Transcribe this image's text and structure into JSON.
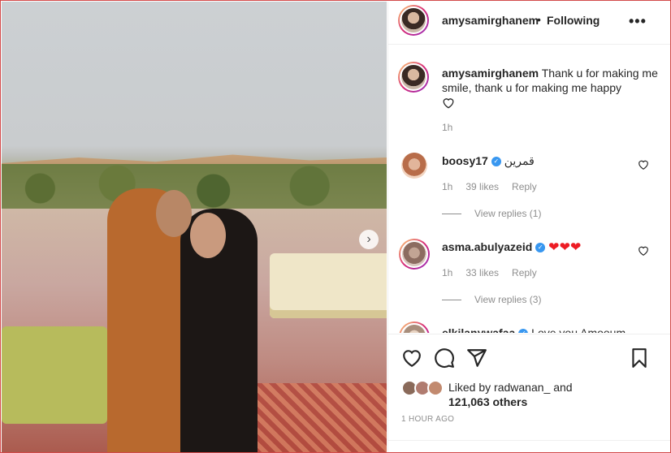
{
  "post": {
    "username": "amysamirghanem",
    "separator": "•",
    "follow_status": "Following",
    "more_label": "•••",
    "next_arrow": "›"
  },
  "caption": {
    "username": "amysamirghanem",
    "text": "Thank u for making me smile, thank u for making me happy",
    "time": "1h"
  },
  "comments": [
    {
      "username": "boosy17",
      "text": "قمرين",
      "time": "1h",
      "likes": "39 likes",
      "reply": "Reply",
      "view_replies": "View replies (1)"
    },
    {
      "username": "asma.abulyazeid",
      "text": "❤❤❤",
      "time": "1h",
      "likes": "33 likes",
      "reply": "Reply",
      "view_replies": "View replies (3)"
    },
    {
      "username": "elkilanywafaa",
      "text": "Love you Amooum"
    }
  ],
  "likes": {
    "prefix": "Liked by",
    "user": "radwanan_",
    "conj": "and",
    "others": "121,063 others"
  },
  "posted_ago": "1 HOUR AGO",
  "icons": {
    "verified": "verified-badge-icon",
    "heart": "heart-icon",
    "comment": "comment-icon",
    "share": "share-icon",
    "save": "bookmark-icon"
  },
  "colors": {
    "accent_blue": "#3897f0",
    "heart_red": "#ed1c24",
    "frame_border": "#d24a4a"
  }
}
